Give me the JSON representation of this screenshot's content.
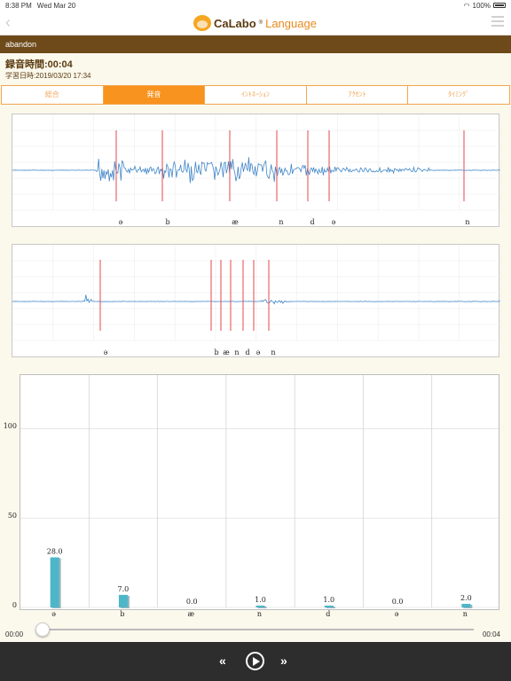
{
  "status_bar": {
    "time": "8:38 PM",
    "date": "Wed Mar 20",
    "battery": "100%"
  },
  "nav": {
    "back_icon": "chevron-left-icon",
    "logo_main": "CaLabo",
    "logo_reg": "®",
    "logo_sub": "Language",
    "menu_icon": "hamburger-menu-icon"
  },
  "word": "abandon",
  "recording_time": "録音時間:00:04",
  "study_date": "学習日時:2019/03/20 17:34",
  "tabs": [
    {
      "label": "総合",
      "active": false
    },
    {
      "label": "発音",
      "active": true
    },
    {
      "label": "ｲﾝﾄﾈｰｼｮﾝ",
      "active": false
    },
    {
      "label": "ｱｸｾﾝﾄ",
      "active": false
    },
    {
      "label": "ﾀｲﾐﾝｸﾞ",
      "active": false
    }
  ],
  "waveform_user": {
    "phonemes": [
      "ə",
      "b",
      "æ",
      "n",
      "d",
      "ə",
      "n"
    ]
  },
  "waveform_model": {
    "phonemes": [
      "ə",
      "b",
      "æ",
      "n",
      "d",
      "ə",
      "n"
    ]
  },
  "chart_data": {
    "type": "bar",
    "categories": [
      "ə",
      "b",
      "æ",
      "n",
      "d",
      "ə",
      "n"
    ],
    "values": [
      28.0,
      7.0,
      0.0,
      1.0,
      1.0,
      0.0,
      2.0
    ],
    "value_labels": [
      "28.0",
      "7.0",
      "0.0",
      "1.0",
      "1.0",
      "0.0",
      "2.0"
    ],
    "ylim": [
      0,
      130
    ],
    "yticks": [
      0,
      50,
      100
    ],
    "ytick_labels": [
      "0",
      "50",
      "100"
    ],
    "grid": true,
    "bar_color": "#4db6c8"
  },
  "player": {
    "time_start": "00:00",
    "time_end": "00:04",
    "progress": 0.0,
    "prev_label": "«",
    "next_label": "»"
  },
  "colors": {
    "accent": "#f7931e",
    "header_brown": "#6e4a1b",
    "marker_red": "#e8474d",
    "wave_blue": "#3f86c8"
  }
}
